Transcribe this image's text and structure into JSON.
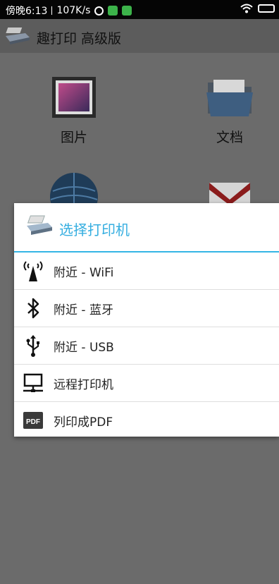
{
  "status_bar": {
    "left_text": "傍晚6:13",
    "speed": "107K/s",
    "icons": [
      "alarm-icon",
      "green-app-icon",
      "green-app-icon",
      "wifi-icon",
      "battery-icon"
    ]
  },
  "app_bar": {
    "title": "趣打印 高级版",
    "icon": "printer-icon"
  },
  "tiles": [
    {
      "label": "图片",
      "icon": "picture-icon"
    },
    {
      "label": "文档",
      "icon": "folder-icon"
    },
    {
      "label": "",
      "icon": "globe-icon"
    },
    {
      "label": "",
      "icon": "gmail-icon"
    }
  ],
  "dialog": {
    "title": "选择打印机",
    "accent": "#35b5e5",
    "options": [
      {
        "label": "附近 - WiFi",
        "icon": "wifi-antenna-icon"
      },
      {
        "label": "附近 - 蓝牙",
        "icon": "bluetooth-icon"
      },
      {
        "label": "附近 - USB",
        "icon": "usb-icon"
      },
      {
        "label": "远程打印机",
        "icon": "remote-computer-icon"
      },
      {
        "label": "列印成PDF",
        "icon": "pdf-icon"
      }
    ]
  }
}
